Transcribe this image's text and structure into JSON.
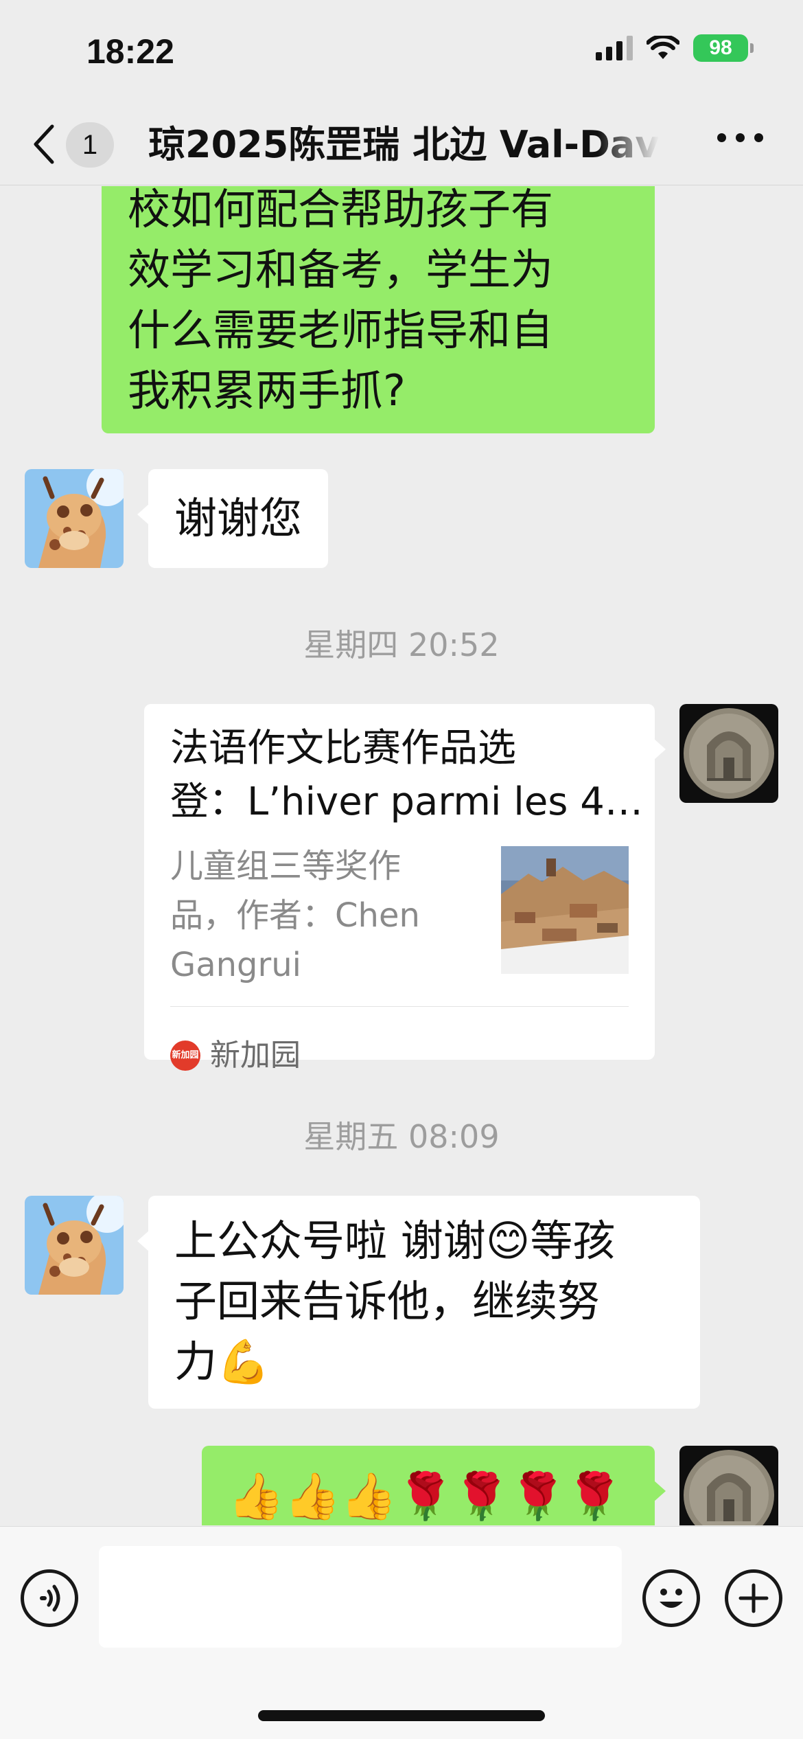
{
  "status_bar": {
    "time": "18:22",
    "battery": "98"
  },
  "nav": {
    "unread_count": "1",
    "title": "琼2025陈罡瑞 北边 Val-Dav"
  },
  "messages": {
    "m1": {
      "lines": [
        "校如何配合帮助孩子有",
        "效学习和备考，学生为",
        "什么需要老师指导和自",
        "我积累两手抓?"
      ]
    },
    "m2": {
      "text": "谢谢您"
    },
    "ts1": "星期四 20:52",
    "card": {
      "title_lines": [
        "法语作文比赛作品选",
        "登：L’hiver parmi les 4…"
      ],
      "desc_lines": [
        "儿童组三等奖作",
        "品，作者：Chen",
        "Gangrui"
      ],
      "source_logo_text": "新加园",
      "source_name": "新加园"
    },
    "ts2": "星期五 08:09",
    "m3": {
      "lines": [
        "上公众号啦 谢谢😊等孩",
        "子回来告诉他，继续努",
        "力💪"
      ]
    },
    "m4": {
      "text": "👍👍👍🌹🌹🌹🌹"
    }
  },
  "input": {
    "placeholder": ""
  },
  "icons": {
    "voice": "voice-icon",
    "emoji": "emoji-icon",
    "plus": "plus-icon",
    "back": "back-chevron-icon",
    "more": "more-icon"
  }
}
